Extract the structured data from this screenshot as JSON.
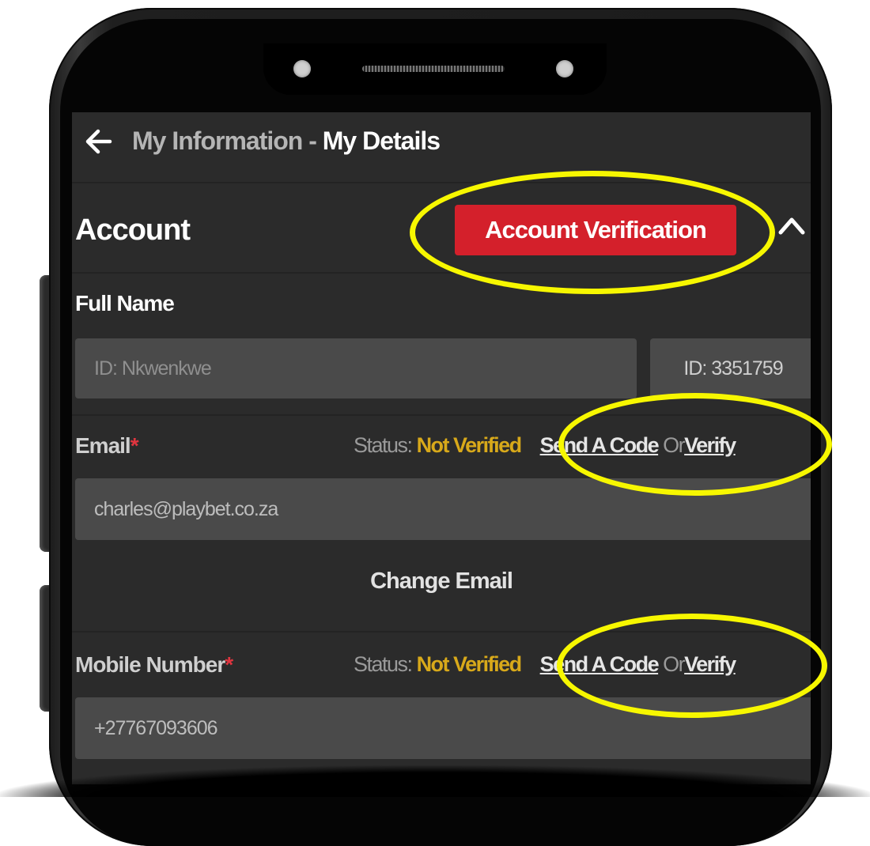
{
  "header": {
    "breadcrumb_parent": "My Information",
    "breadcrumb_separator": " - ",
    "breadcrumb_current": "My Details",
    "back_icon": "arrow-left-icon"
  },
  "account": {
    "title": "Account",
    "verification_button": "Account Verification",
    "collapse_icon": "chevron-up-icon"
  },
  "full_name": {
    "label": "Full Name",
    "name_value": "ID: Nkwenkwe",
    "id_value": "ID: 3351759"
  },
  "email": {
    "label": "Email",
    "required_mark": "*",
    "status_label": "Status:",
    "status_value": "Not Verified",
    "send_code": "Send A Code",
    "or": "Or",
    "verify": "Verify",
    "value": "charles@playbet.co.za",
    "change_label": "Change Email"
  },
  "mobile": {
    "label": "Mobile Number",
    "required_mark": "*",
    "status_label": "Status:",
    "status_value": "Not Verified",
    "send_code": "Send A Code",
    "or": "Or",
    "verify": "Verify",
    "value": "+27767093606"
  },
  "colors": {
    "accent_red": "#d4202b",
    "status_yellow": "#d8a91a",
    "highlight_yellow": "#f7f700",
    "screen_bg": "#2b2b2b"
  }
}
